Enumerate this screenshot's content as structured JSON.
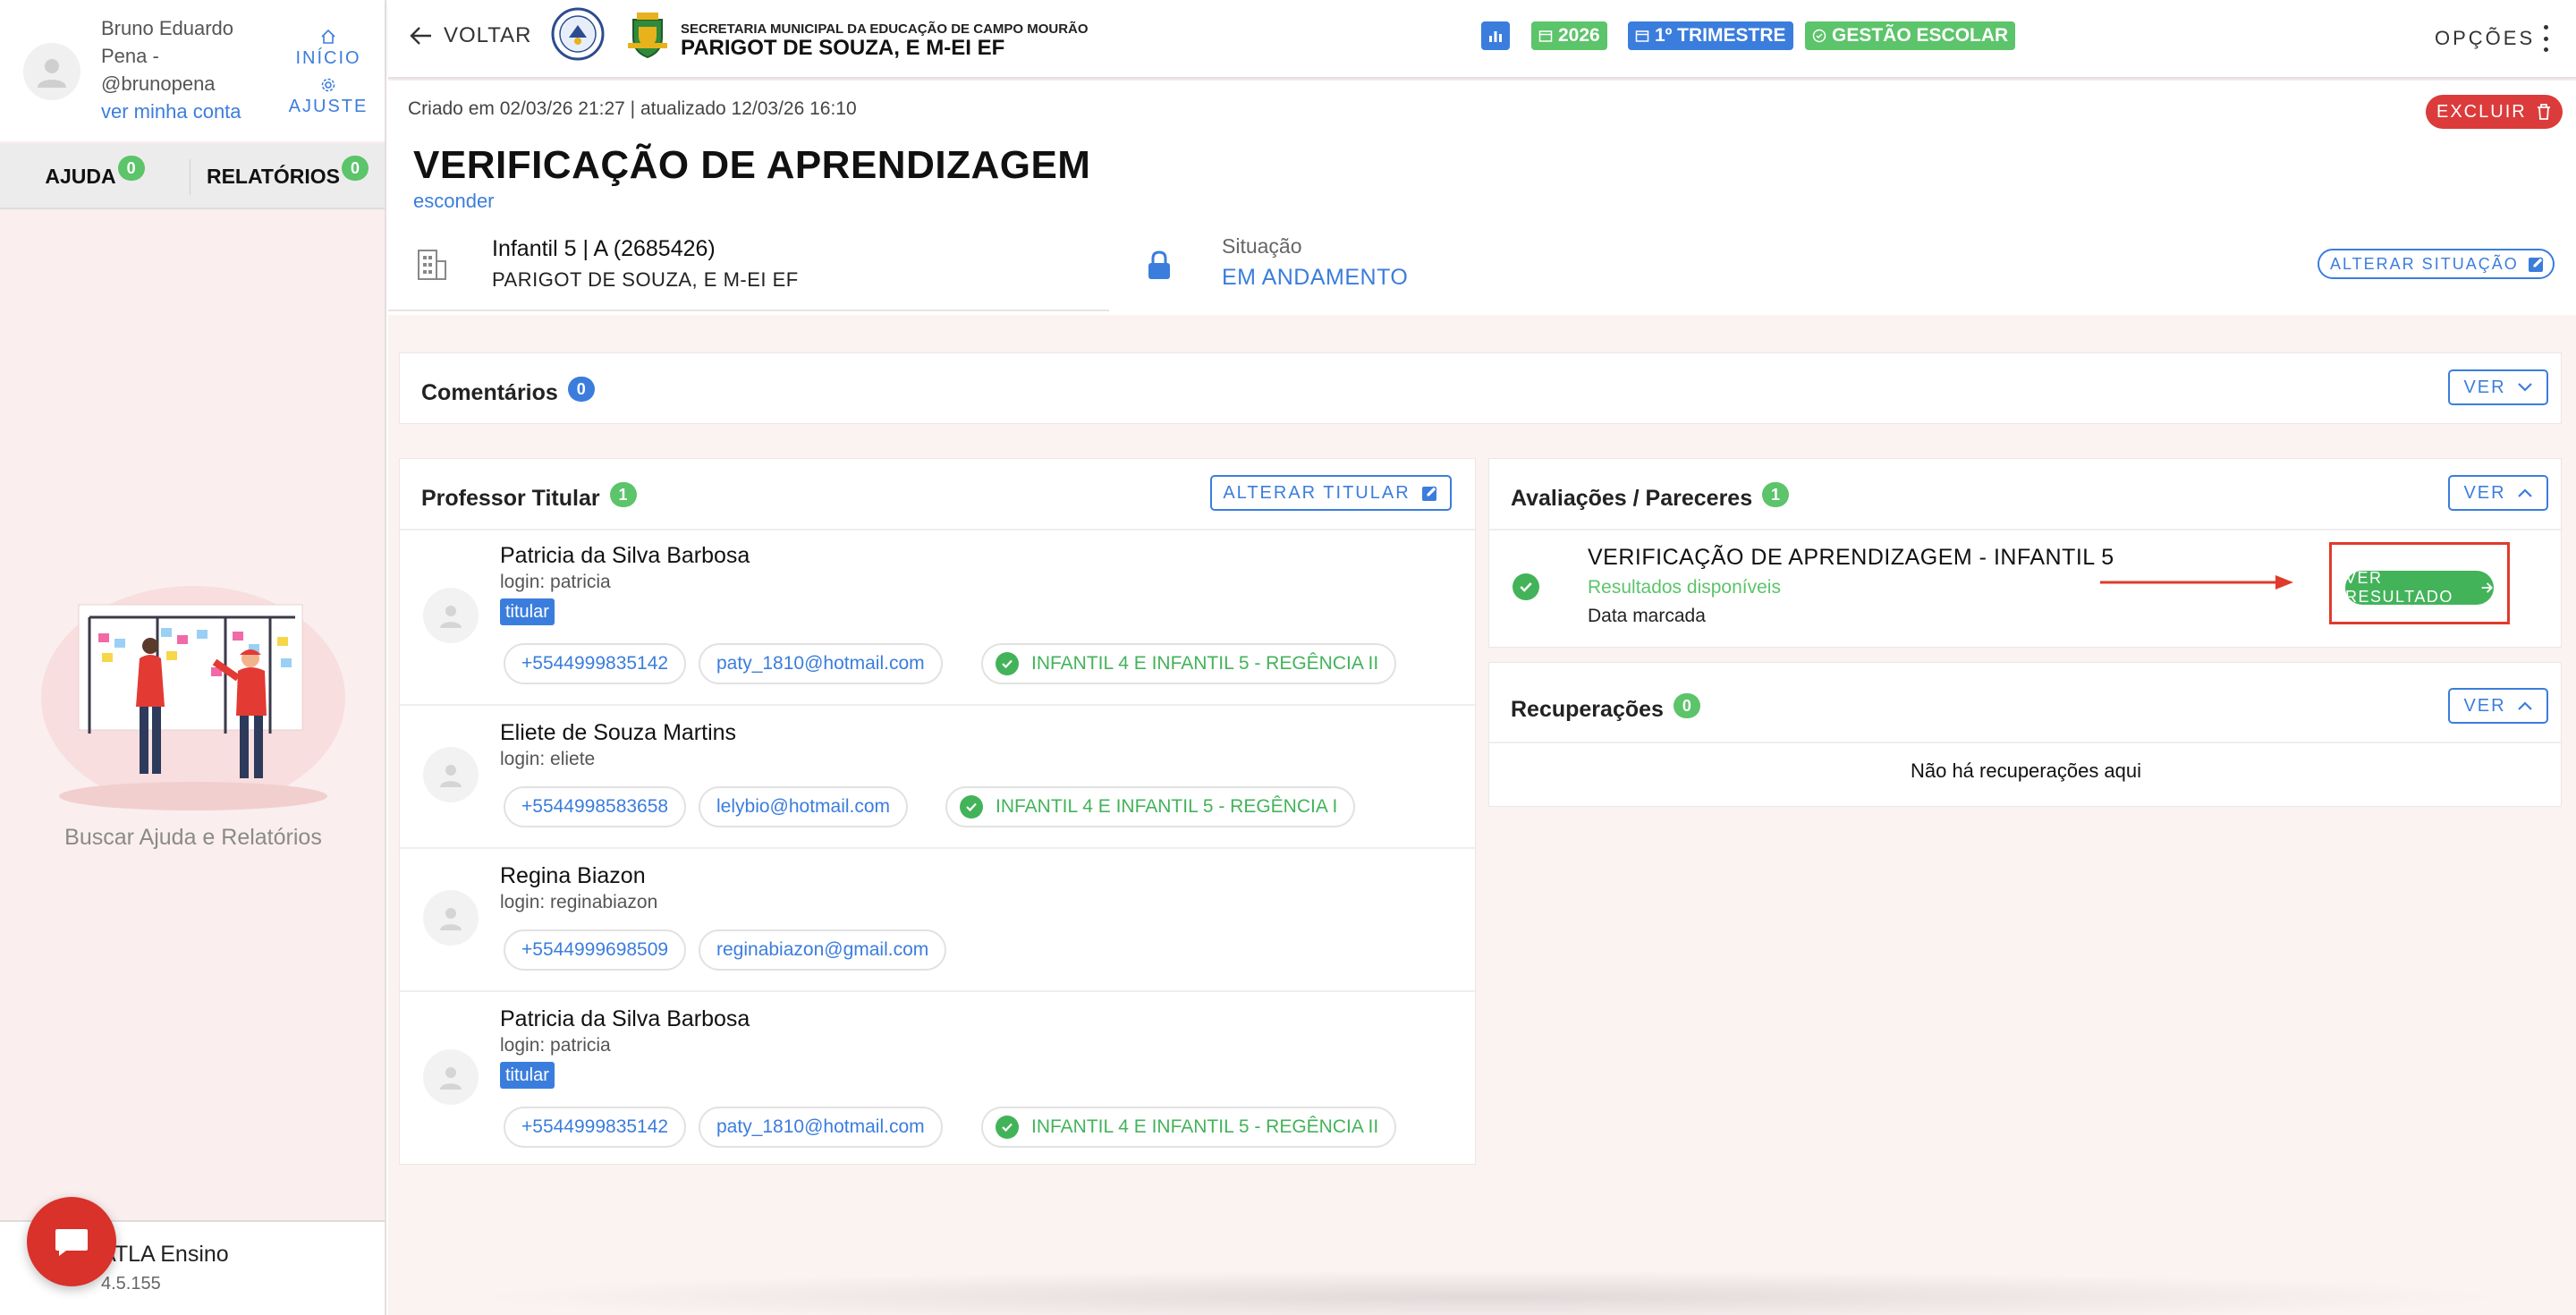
{
  "sidebar": {
    "user_name": "Bruno Eduardo Pena - @brunopena",
    "account_link": "ver minha conta",
    "inicio_label": "INÍCIO",
    "ajuste_label": "AJUSTE",
    "tabs": [
      {
        "label": "AJUDA",
        "count": "0"
      },
      {
        "label": "RELATÓRIOS",
        "count": "0"
      }
    ],
    "help_text": "Buscar Ajuda e Relatórios",
    "app_name": "ATLA Ensino",
    "app_version": "4.5.155"
  },
  "topbar": {
    "back_label": "VOLTAR",
    "secretaria": "SECRETARIA MUNICIPAL DA EDUCAÇÃO DE CAMPO MOURÃO",
    "school": "PARIGOT DE SOUZA, E M-EI EF",
    "chips": {
      "year": "2026",
      "term": "1º TRIMESTRE",
      "mode": "GESTÃO ESCOLAR"
    },
    "options_label": "OPÇÕES"
  },
  "header": {
    "created": "Criado em 02/03/26 21:27 | atualizado 12/03/26 16:10",
    "delete_label": "EXCLUIR",
    "title": "VERIFICAÇÃO DE APRENDIZAGEM",
    "hide_link": "esconder",
    "class_name": "Infantil 5 | A (2685426)",
    "class_school": "PARIGOT DE SOUZA, E M-EI EF",
    "status_label": "Situação",
    "status_value": "EM ANDAMENTO",
    "change_status_label": "ALTERAR SITUAÇÃO"
  },
  "comments": {
    "title": "Comentários",
    "count": "0",
    "ver_label": "VER"
  },
  "professors": {
    "title": "Professor Titular",
    "count": "1",
    "change_label": "ALTERAR TITULAR",
    "items": [
      {
        "name": "Patricia da Silva Barbosa",
        "login": "login: patricia",
        "tag": "titular",
        "phone": "+5544999835142",
        "email": "paty_1810@hotmail.com",
        "subject": "INFANTIL 4 E INFANTIL 5 - REGÊNCIA II"
      },
      {
        "name": "Eliete de Souza Martins",
        "login": "login: eliete",
        "tag": "",
        "phone": "+5544998583658",
        "email": "lelybio@hotmail.com",
        "subject": "INFANTIL 4 E INFANTIL 5 - REGÊNCIA I"
      },
      {
        "name": "Regina Biazon",
        "login": "login: reginabiazon",
        "tag": "",
        "phone": "+5544999698509",
        "email": "reginabiazon@gmail.com",
        "subject": ""
      },
      {
        "name": "Patricia da Silva Barbosa",
        "login": "login: patricia",
        "tag": "titular",
        "phone": "+5544999835142",
        "email": "paty_1810@hotmail.com",
        "subject": "INFANTIL 4 E INFANTIL 5 - REGÊNCIA II"
      }
    ]
  },
  "evaluations": {
    "title": "Avaliações / Pareceres",
    "count": "1",
    "ver_label": "VER",
    "item": {
      "name": "VERIFICAÇÃO DE APRENDIZAGEM - INFANTIL 5",
      "status": "Resultados disponíveis",
      "date": "Data marcada",
      "result_label": "VER RESULTADO"
    }
  },
  "recoveries": {
    "title": "Recuperações",
    "count": "0",
    "ver_label": "VER",
    "empty": "Não há recuperações aqui"
  },
  "colors": {
    "accent": "#3b7ddd",
    "success": "#43b35a",
    "danger": "#dc3b3b",
    "highlight": "#e03a2d"
  }
}
